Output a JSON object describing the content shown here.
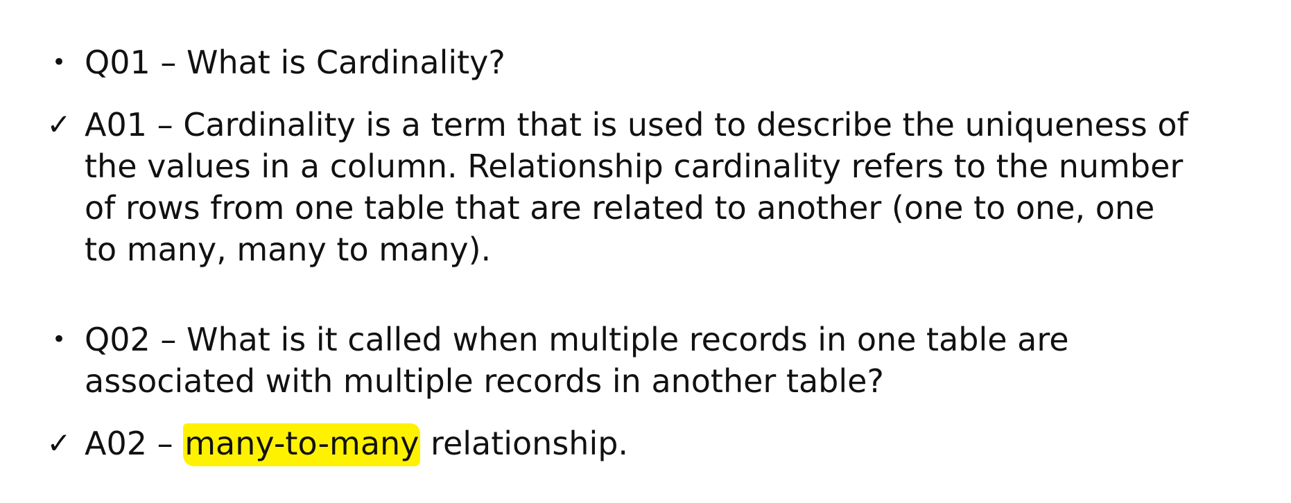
{
  "items": {
    "q01": {
      "marker": "•",
      "lines": [
        "Q01 – What is Cardinality?"
      ]
    },
    "a01": {
      "marker": "✓",
      "lines": [
        "A01 – Cardinality is a term that is used to describe the uniqueness of",
        "the values in a column. Relationship cardinality refers to the number",
        "of rows from one table that are related to another (one to one, one",
        "to many, many to many)."
      ]
    },
    "q02": {
      "marker": "•",
      "lines": [
        "Q02 – What is it called when multiple records in one table are",
        "associated with multiple records in another table?"
      ]
    },
    "a02": {
      "marker": "✓",
      "prefix": "A02 – ",
      "highlight": "many-to-many",
      "suffix": " relationship."
    }
  },
  "colors": {
    "text": "#111111",
    "highlight": "#fff200",
    "background": "#ffffff"
  }
}
